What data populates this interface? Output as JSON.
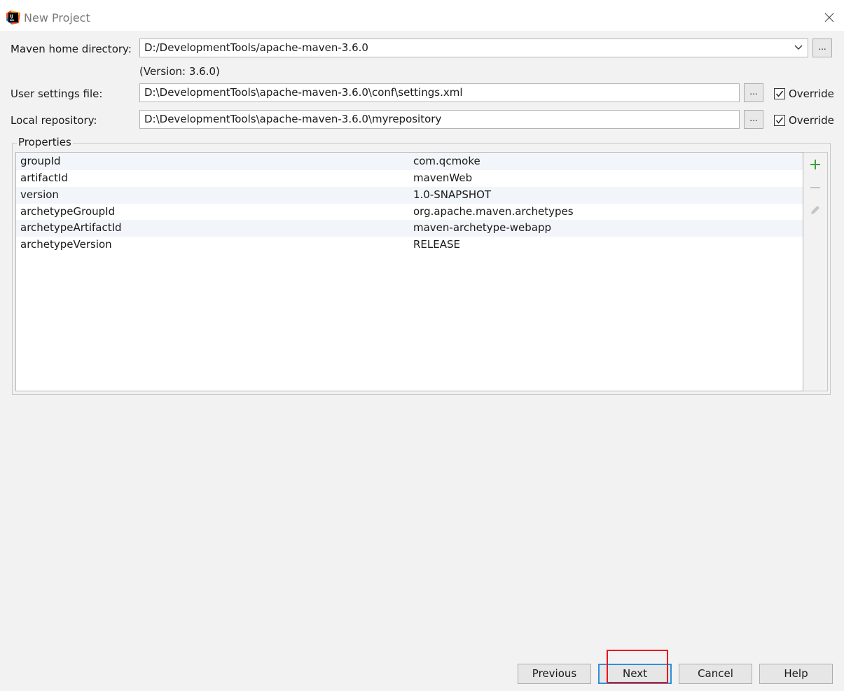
{
  "window": {
    "title": "New Project"
  },
  "form": {
    "maven_home": {
      "label": "Maven home directory:",
      "value": "D:/DevelopmentTools/apache-maven-3.6.0",
      "version_note": "(Version: 3.6.0)"
    },
    "user_settings": {
      "label": "User settings file:",
      "value": "D:\\DevelopmentTools\\apache-maven-3.6.0\\conf\\settings.xml",
      "override_label": "Override",
      "override_checked": true
    },
    "local_repository": {
      "label": "Local repository:",
      "value": "D:\\DevelopmentTools\\apache-maven-3.6.0\\myrepository",
      "override_label": "Override",
      "override_checked": true
    },
    "browse_label": "..."
  },
  "properties": {
    "title": "Properties",
    "rows": [
      {
        "key": "groupId",
        "value": "com.qcmoke"
      },
      {
        "key": "artifactId",
        "value": "mavenWeb"
      },
      {
        "key": "version",
        "value": "1.0-SNAPSHOT"
      },
      {
        "key": "archetypeGroupId",
        "value": "org.apache.maven.archetypes"
      },
      {
        "key": "archetypeArtifactId",
        "value": "maven-archetype-webapp"
      },
      {
        "key": "archetypeVersion",
        "value": "RELEASE"
      }
    ],
    "tools": [
      "plus-icon",
      "minus-icon",
      "pencil-icon"
    ]
  },
  "buttons": {
    "previous": "Previous",
    "next": "Next",
    "cancel": "Cancel",
    "help": "Help"
  },
  "colors": {
    "accent_blue": "#2f8fdb",
    "highlight_red": "#e8141c",
    "add_green": "#3a9e3a"
  }
}
